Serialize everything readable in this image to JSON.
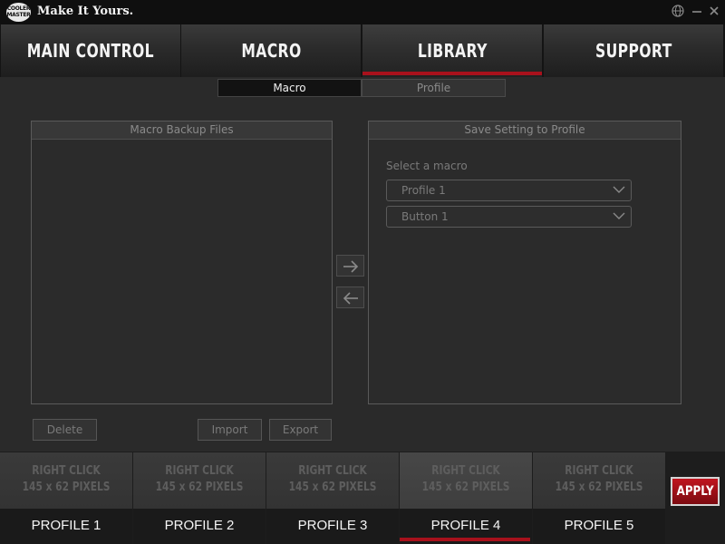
{
  "window": {
    "logo_text": "COOLER MASTER",
    "tagline": "Make It Yours.",
    "controls": [
      "globe-icon",
      "minimize-icon",
      "close-icon"
    ]
  },
  "nav": {
    "tabs": [
      {
        "label": "MAIN CONTROL",
        "active": false
      },
      {
        "label": "MACRO",
        "active": false
      },
      {
        "label": "LIBRARY",
        "active": true
      },
      {
        "label": "SUPPORT",
        "active": false
      }
    ]
  },
  "subtabs": [
    {
      "label": "Macro",
      "active": true
    },
    {
      "label": "Profile",
      "active": false
    }
  ],
  "left_panel": {
    "title": "Macro Backup Files",
    "items": []
  },
  "right_panel": {
    "title": "Save Setting to Profile",
    "select_label": "Select a macro",
    "profile_dropdown": "Profile 1",
    "button_dropdown": "Button 1"
  },
  "transfer": {
    "right_icon": "arrow-right-icon",
    "left_icon": "arrow-left-icon"
  },
  "buttons": {
    "delete": "Delete",
    "import": "Import",
    "export": "Export"
  },
  "profiles": [
    {
      "hint1": "RIGHT CLICK",
      "hint2": "145 x 62 PIXELS",
      "name": "PROFILE 1",
      "active": false
    },
    {
      "hint1": "RIGHT CLICK",
      "hint2": "145 x 62 PIXELS",
      "name": "PROFILE 2",
      "active": false
    },
    {
      "hint1": "RIGHT CLICK",
      "hint2": "145 x 62 PIXELS",
      "name": "PROFILE 3",
      "active": false
    },
    {
      "hint1": "RIGHT CLICK",
      "hint2": "145 x 62 PIXELS",
      "name": "PROFILE 4",
      "active": true
    },
    {
      "hint1": "RIGHT CLICK",
      "hint2": "145 x 62 PIXELS",
      "name": "PROFILE 5",
      "active": false
    }
  ],
  "apply_label": "APPLY",
  "colors": {
    "accent": "#a8111c",
    "background": "#2a2a2a",
    "titlebar": "#0f0f0f"
  }
}
